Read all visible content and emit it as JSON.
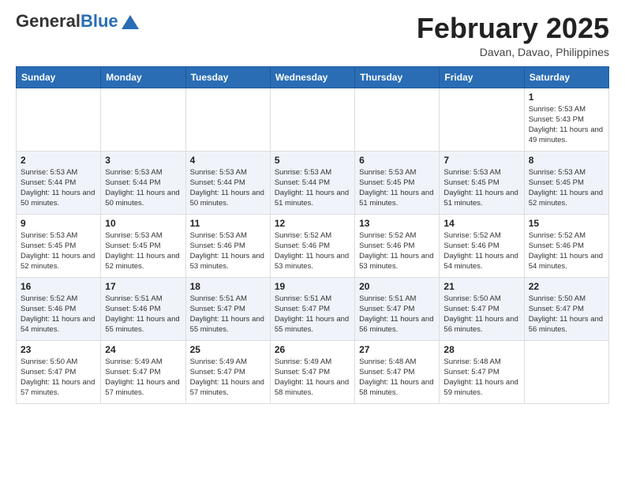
{
  "header": {
    "logo_general": "General",
    "logo_blue": "Blue",
    "month_title": "February 2025",
    "location": "Davan, Davao, Philippines"
  },
  "weekdays": [
    "Sunday",
    "Monday",
    "Tuesday",
    "Wednesday",
    "Thursday",
    "Friday",
    "Saturday"
  ],
  "weeks": [
    [
      {
        "day": "",
        "info": ""
      },
      {
        "day": "",
        "info": ""
      },
      {
        "day": "",
        "info": ""
      },
      {
        "day": "",
        "info": ""
      },
      {
        "day": "",
        "info": ""
      },
      {
        "day": "",
        "info": ""
      },
      {
        "day": "1",
        "info": "Sunrise: 5:53 AM\nSunset: 5:43 PM\nDaylight: 11 hours\nand 49 minutes."
      }
    ],
    [
      {
        "day": "2",
        "info": "Sunrise: 5:53 AM\nSunset: 5:44 PM\nDaylight: 11 hours\nand 50 minutes."
      },
      {
        "day": "3",
        "info": "Sunrise: 5:53 AM\nSunset: 5:44 PM\nDaylight: 11 hours\nand 50 minutes."
      },
      {
        "day": "4",
        "info": "Sunrise: 5:53 AM\nSunset: 5:44 PM\nDaylight: 11 hours\nand 50 minutes."
      },
      {
        "day": "5",
        "info": "Sunrise: 5:53 AM\nSunset: 5:44 PM\nDaylight: 11 hours\nand 51 minutes."
      },
      {
        "day": "6",
        "info": "Sunrise: 5:53 AM\nSunset: 5:45 PM\nDaylight: 11 hours\nand 51 minutes."
      },
      {
        "day": "7",
        "info": "Sunrise: 5:53 AM\nSunset: 5:45 PM\nDaylight: 11 hours\nand 51 minutes."
      },
      {
        "day": "8",
        "info": "Sunrise: 5:53 AM\nSunset: 5:45 PM\nDaylight: 11 hours\nand 52 minutes."
      }
    ],
    [
      {
        "day": "9",
        "info": "Sunrise: 5:53 AM\nSunset: 5:45 PM\nDaylight: 11 hours\nand 52 minutes."
      },
      {
        "day": "10",
        "info": "Sunrise: 5:53 AM\nSunset: 5:45 PM\nDaylight: 11 hours\nand 52 minutes."
      },
      {
        "day": "11",
        "info": "Sunrise: 5:53 AM\nSunset: 5:46 PM\nDaylight: 11 hours\nand 53 minutes."
      },
      {
        "day": "12",
        "info": "Sunrise: 5:52 AM\nSunset: 5:46 PM\nDaylight: 11 hours\nand 53 minutes."
      },
      {
        "day": "13",
        "info": "Sunrise: 5:52 AM\nSunset: 5:46 PM\nDaylight: 11 hours\nand 53 minutes."
      },
      {
        "day": "14",
        "info": "Sunrise: 5:52 AM\nSunset: 5:46 PM\nDaylight: 11 hours\nand 54 minutes."
      },
      {
        "day": "15",
        "info": "Sunrise: 5:52 AM\nSunset: 5:46 PM\nDaylight: 11 hours\nand 54 minutes."
      }
    ],
    [
      {
        "day": "16",
        "info": "Sunrise: 5:52 AM\nSunset: 5:46 PM\nDaylight: 11 hours\nand 54 minutes."
      },
      {
        "day": "17",
        "info": "Sunrise: 5:51 AM\nSunset: 5:46 PM\nDaylight: 11 hours\nand 55 minutes."
      },
      {
        "day": "18",
        "info": "Sunrise: 5:51 AM\nSunset: 5:47 PM\nDaylight: 11 hours\nand 55 minutes."
      },
      {
        "day": "19",
        "info": "Sunrise: 5:51 AM\nSunset: 5:47 PM\nDaylight: 11 hours\nand 55 minutes."
      },
      {
        "day": "20",
        "info": "Sunrise: 5:51 AM\nSunset: 5:47 PM\nDaylight: 11 hours\nand 56 minutes."
      },
      {
        "day": "21",
        "info": "Sunrise: 5:50 AM\nSunset: 5:47 PM\nDaylight: 11 hours\nand 56 minutes."
      },
      {
        "day": "22",
        "info": "Sunrise: 5:50 AM\nSunset: 5:47 PM\nDaylight: 11 hours\nand 56 minutes."
      }
    ],
    [
      {
        "day": "23",
        "info": "Sunrise: 5:50 AM\nSunset: 5:47 PM\nDaylight: 11 hours\nand 57 minutes."
      },
      {
        "day": "24",
        "info": "Sunrise: 5:49 AM\nSunset: 5:47 PM\nDaylight: 11 hours\nand 57 minutes."
      },
      {
        "day": "25",
        "info": "Sunrise: 5:49 AM\nSunset: 5:47 PM\nDaylight: 11 hours\nand 57 minutes."
      },
      {
        "day": "26",
        "info": "Sunrise: 5:49 AM\nSunset: 5:47 PM\nDaylight: 11 hours\nand 58 minutes."
      },
      {
        "day": "27",
        "info": "Sunrise: 5:48 AM\nSunset: 5:47 PM\nDaylight: 11 hours\nand 58 minutes."
      },
      {
        "day": "28",
        "info": "Sunrise: 5:48 AM\nSunset: 5:47 PM\nDaylight: 11 hours\nand 59 minutes."
      },
      {
        "day": "",
        "info": ""
      }
    ]
  ]
}
